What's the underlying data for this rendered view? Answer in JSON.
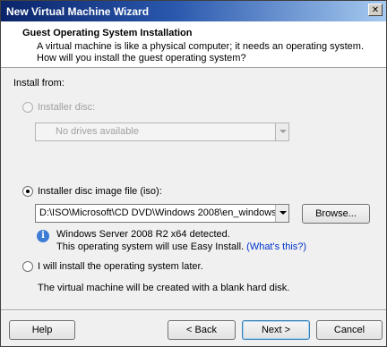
{
  "window": {
    "title": "New Virtual Machine Wizard",
    "close_glyph": "✕"
  },
  "header": {
    "title": "Guest Operating System Installation",
    "description": "A virtual machine is like a physical computer; it needs an operating system. How will you install the guest operating system?"
  },
  "install_from_label": "Install from:",
  "installer_disc": {
    "label": "Installer disc:",
    "selected": false,
    "enabled": false,
    "drive_value": "No drives available"
  },
  "iso": {
    "label": "Installer disc image file (iso):",
    "selected": true,
    "path": "D:\\ISO\\Microsoft\\CD DVD\\Windows 2008\\en_windows",
    "browse_label": "Browse...",
    "detected_text": "Windows Server 2008 R2 x64 detected.",
    "easy_install_text": "This operating system will use Easy Install.",
    "whats_this_link": "(What's this?)"
  },
  "later": {
    "label": "I will install the operating system later.",
    "selected": false,
    "note": "The virtual machine will be created with a blank hard disk."
  },
  "footer": {
    "help_label": "Help",
    "back_label": "< Back",
    "next_label": "Next >",
    "cancel_label": "Cancel"
  },
  "icons": {
    "info": "info-icon",
    "close": "close-icon",
    "dropdown": "chevron-down-icon"
  }
}
